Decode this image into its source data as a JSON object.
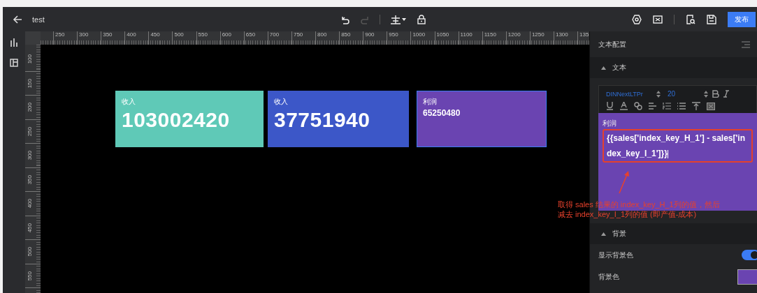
{
  "window": {
    "title": "test"
  },
  "toolbar": {
    "redo_disabled": true,
    "publish_button": "发布"
  },
  "ruler": {
    "x_labels": [
      "250",
      "300",
      "350",
      "400",
      "450",
      "500",
      "550",
      "600",
      "650",
      "700",
      "750",
      "800",
      "850",
      "900",
      "950",
      "1000",
      "1050",
      "1100",
      "1150",
      "1200",
      "1250",
      "1300",
      "135"
    ],
    "y_labels": [
      "100",
      "150",
      "200",
      "250",
      "300",
      "350",
      "400",
      "450",
      "500",
      "550"
    ]
  },
  "cards": [
    {
      "label": "收入",
      "value": "103002420",
      "kind": "large",
      "color": "#5fc9b7",
      "selected": false
    },
    {
      "label": "收入",
      "value": "37751940",
      "kind": "large",
      "color": "#3c57c8",
      "selected": false
    },
    {
      "label": "利润",
      "value": "65250480",
      "kind": "small",
      "color": "#6a44b1",
      "selected": true
    }
  ],
  "annotation": {
    "lines": [
      "取得 sales 结果的 index_key_H_1列的值，然后",
      "减去 index_key_I_1列的值 (即产值-成本)"
    ]
  },
  "panel": {
    "title": "文本配置",
    "text_section": {
      "title": "文本",
      "expanded": true,
      "font": "DINNextLTPr",
      "size": "20",
      "preview_label": "利润",
      "formula": "{{sales['index_key_H_1'] - sales['index_key_I_1']}}"
    },
    "background_section": {
      "title": "背景",
      "expanded": true,
      "show_label": "显示背景色",
      "show_on": true,
      "color_label": "背景色",
      "color": "#6a44b1"
    }
  }
}
